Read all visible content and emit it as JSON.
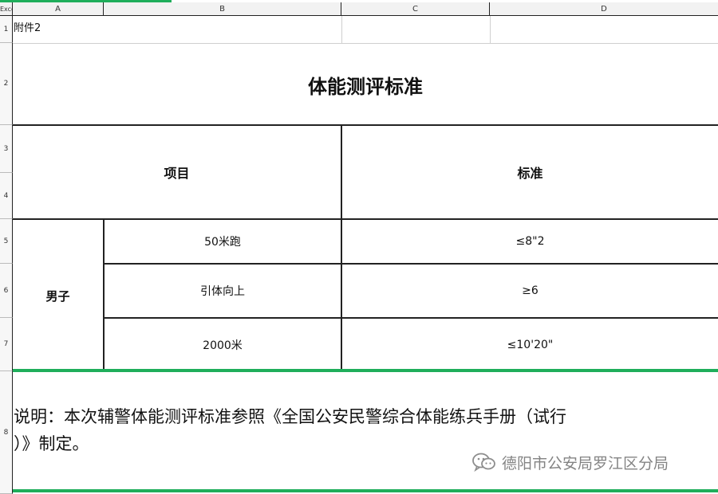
{
  "sheet": {
    "corner_label": "Excel",
    "columns": [
      "A",
      "B",
      "C",
      "D"
    ],
    "rows": [
      "1",
      "2",
      "3",
      "4",
      "5",
      "6",
      "7",
      "8"
    ]
  },
  "doc": {
    "attachment": "附件2",
    "title": "体能测评标准",
    "header_item": "项目",
    "header_standard": "标准",
    "group_label": "男子",
    "items": [
      {
        "name": "50米跑",
        "standard": "≤8\"2"
      },
      {
        "name": "引体向上",
        "standard": "≥6"
      },
      {
        "name": "2000米",
        "standard": "≤10'20\""
      }
    ],
    "note_line1": "说明：本次辅警体能测评标准参照《全国公安民警综合体能练兵手册（试行",
    "note_line2": "）》制定。"
  },
  "watermark": {
    "icon": "wechat-icon",
    "text": "德阳市公安局罗江区分局"
  },
  "colors": {
    "accent_green": "#1fae5b"
  }
}
